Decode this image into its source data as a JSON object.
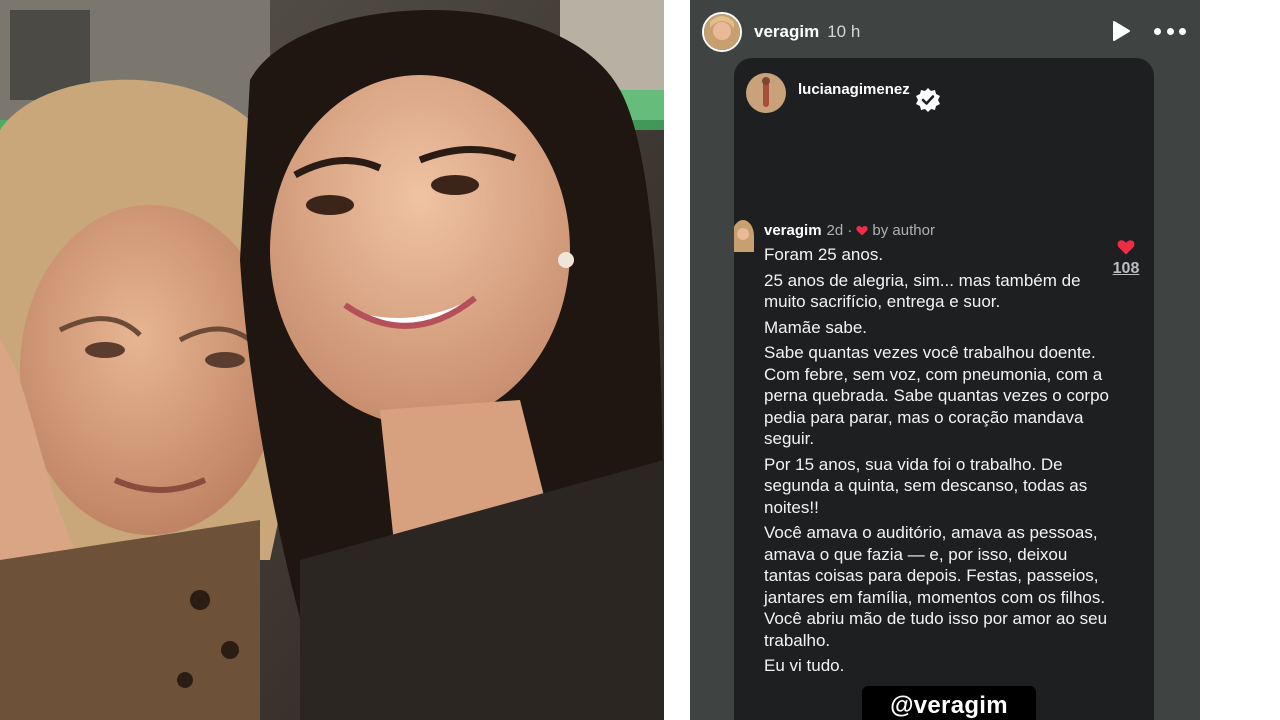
{
  "story": {
    "username": "veragim",
    "time": "10 h"
  },
  "shared_post": {
    "username": "lucianagimenez",
    "comment": {
      "username": "veragim",
      "age": "2d",
      "by_author": "by author",
      "paragraphs": [
        "Foram 25 anos.",
        "25 anos de alegria, sim... mas também de muito sacrifício, entrega e suor.",
        "Mamãe sabe.",
        "Sabe quantas vezes você trabalhou doente. Com febre, sem voz, com pneumonia, com a perna quebrada. Sabe quantas vezes o corpo pedia para parar, mas o coração mandava seguir.",
        "Por 15 anos, sua vida foi o trabalho. De segunda a quinta, sem descanso, todas as noites!!",
        "Você amava o auditório, amava as pessoas, amava o que fazia — e, por isso, deixou tantas coisas para depois. Festas, passeios, jantares em família, momentos com os filhos. Você abriu mão de tudo isso por amor ao seu trabalho.",
        "Eu vi tudo."
      ],
      "likes": "108"
    }
  },
  "mention_sticker": "@veragim",
  "icons": {
    "play": "play-icon",
    "more": "more-options-icon",
    "verified": "verified-badge-icon",
    "like": "heart-icon"
  },
  "colors": {
    "story_bg": "#3f4342",
    "card_bg": "#1e1f21",
    "heart": "#ed2d44",
    "muted_text": "#aeb0b4"
  }
}
